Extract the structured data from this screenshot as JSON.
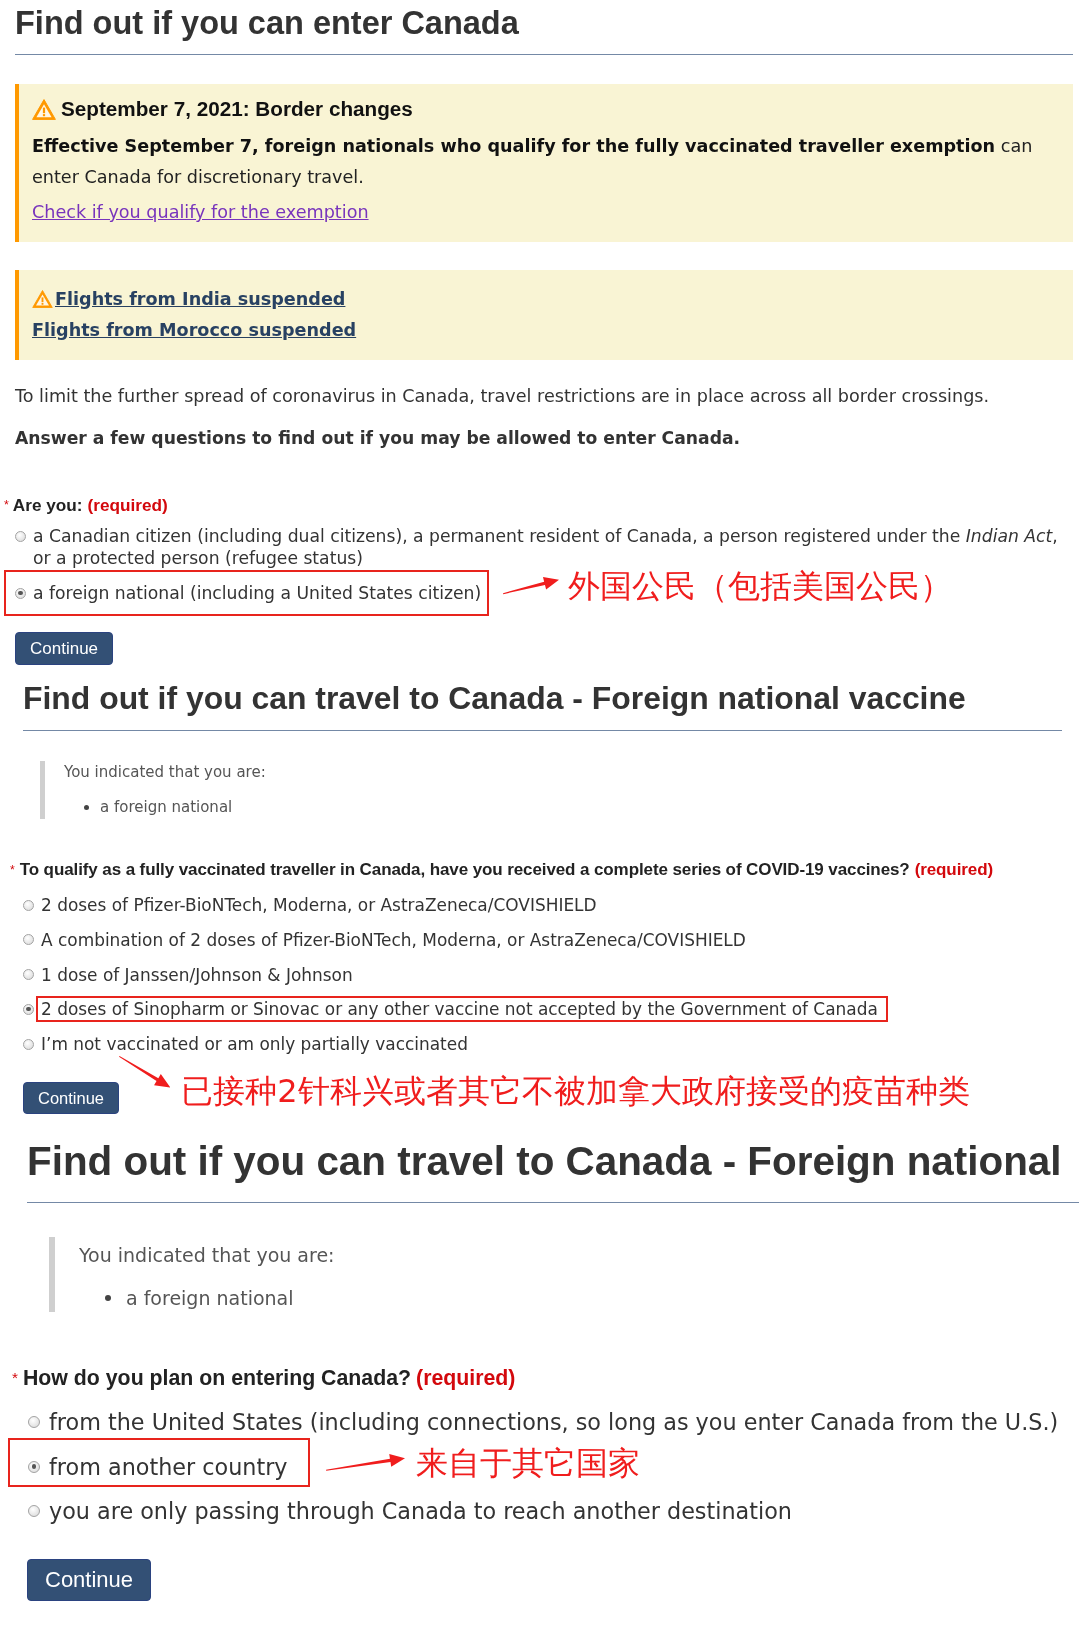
{
  "sections": [
    {
      "title": "Find out if you can enter Canada",
      "alerts": [
        {
          "kind": "notice",
          "heading": "September 7, 2021: Border changes",
          "text": "**Effective September 7, foreign nationals who qualify for the fully vaccinated traveller exemption** can enter Canada for discretionary travel.",
          "links": [
            {
              "label": "Check if you qualify for the exemption",
              "visited": true
            }
          ]
        },
        {
          "kind": "link-list",
          "links": [
            {
              "label": "Flights from India suspended",
              "visited": false
            },
            {
              "label": "Flights from Morocco suspended",
              "visited": false
            }
          ]
        }
      ],
      "paragraphs": [
        {
          "kind": "plain",
          "text": "To limit the further spread of coronavirus in Canada, travel restrictions are in place across all border crossings."
        },
        {
          "kind": "strong",
          "text": "Answer a few questions to find out if you may be allowed to enter Canada."
        }
      ],
      "question": {
        "mark": "*",
        "label": "Are you:",
        "required": "(required)",
        "options": [
          {
            "label": "a Canadian citizen (including dual citizens), a permanent resident of Canada, a person registered under the *Indian Act*, or a protected person (refugee status)",
            "selected": false,
            "highlighted": false
          },
          {
            "label": "a foreign national (including a United States citizen)",
            "selected": true,
            "highlighted": true
          }
        ]
      },
      "button": "Continue",
      "annotation": "外国公民（包括美国公民）"
    },
    {
      "title": "Find out if you can travel to Canada - Foreign national vaccine",
      "summary": {
        "heading": "You indicated that you are:",
        "items": [
          "a foreign national"
        ]
      },
      "question": {
        "mark": "*",
        "label": "To qualify as a fully vaccinated traveller in Canada, have you received a complete series of COVID-19 vaccines?",
        "required": "(required)",
        "options": [
          {
            "label": "2 doses of Pfizer-BioNTech, Moderna, or AstraZeneca/COVISHIELD",
            "selected": false,
            "highlighted": false
          },
          {
            "label": "A combination of 2 doses of Pfizer-BioNTech, Moderna, or AstraZeneca/COVISHIELD",
            "selected": false,
            "highlighted": false
          },
          {
            "label": "1 dose of Janssen/Johnson & Johnson",
            "selected": false,
            "highlighted": false
          },
          {
            "label": "2 doses of Sinopharm or Sinovac or any other vaccine not accepted by the Government of Canada",
            "selected": true,
            "highlighted": true
          },
          {
            "label": "I’m not vaccinated or am only partially vaccinated",
            "selected": false,
            "highlighted": false
          }
        ]
      },
      "button": "Continue",
      "annotation": "已接种2针科兴或者其它不被加拿大政府接受的疫苗种类"
    },
    {
      "title": "Find out if you can travel to Canada - Foreign national",
      "summary": {
        "heading": "You indicated that you are:",
        "items": [
          "a foreign national"
        ]
      },
      "question": {
        "mark": "*",
        "label": "How do you plan on entering Canada?",
        "required": "(required)",
        "options": [
          {
            "label": "from the United States (including connections, so long as you enter Canada from the U.S.)",
            "selected": false,
            "highlighted": false
          },
          {
            "label": "from another country",
            "selected": true,
            "highlighted": true
          },
          {
            "label": "you are only passing through Canada to reach another destination",
            "selected": false,
            "highlighted": false
          }
        ]
      },
      "button": "Continue",
      "annotation": "来自于其它国家"
    }
  ]
}
